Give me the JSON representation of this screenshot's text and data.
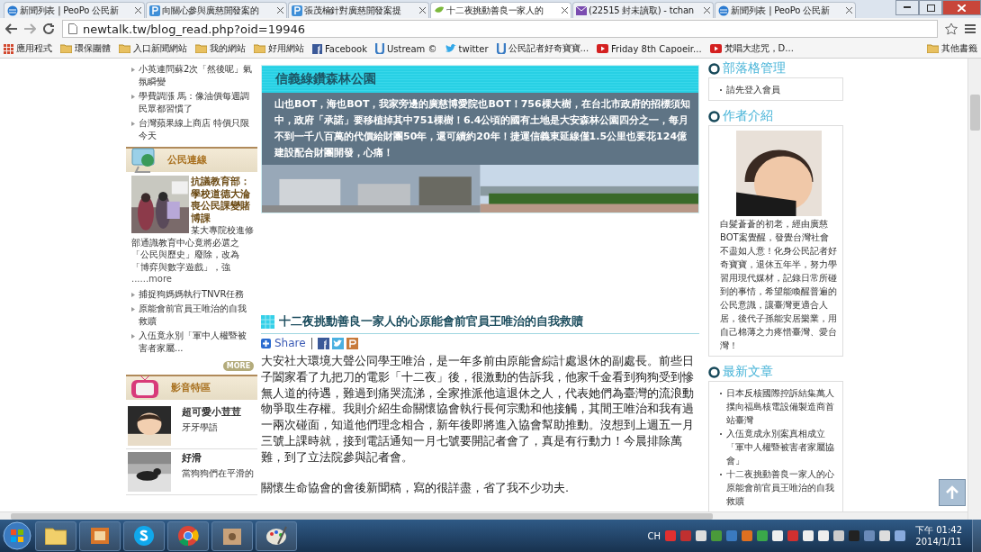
{
  "browser": {
    "tabs": [
      {
        "title": "新聞列表 | PeoPo 公民新",
        "kind": "globe",
        "selected": false
      },
      {
        "title": "向關心參與廣慈開發案的",
        "kind": "p",
        "selected": false
      },
      {
        "title": "張茂楠針對廣慈開發案提",
        "kind": "p",
        "selected": false
      },
      {
        "title": "十二夜挑動善良一家人的",
        "kind": "leaf",
        "selected": true
      },
      {
        "title": "(22515 封未讀取) - tchan",
        "kind": "mail",
        "selected": false
      },
      {
        "title": "新聞列表 | PeoPo 公民新",
        "kind": "globe",
        "selected": false
      }
    ],
    "address": "newtalk.tw/blog_read.php?oid=19946",
    "bookmarks": [
      {
        "label": "應用程式",
        "kind": "apps"
      },
      {
        "label": "環保團體",
        "kind": "folder"
      },
      {
        "label": "入口新聞網站",
        "kind": "folder"
      },
      {
        "label": "我的網站",
        "kind": "folder"
      },
      {
        "label": "好用網站",
        "kind": "folder"
      },
      {
        "label": "Facebook",
        "kind": "facebook"
      },
      {
        "label": "Ustream ©",
        "kind": "ustream"
      },
      {
        "label": "twitter",
        "kind": "twitter"
      },
      {
        "label": "公民記者好奇寶寶...",
        "kind": "ustream"
      },
      {
        "label": "Friday 8th Capoeir...",
        "kind": "youtube"
      },
      {
        "label": "梵唱大悲咒，D...",
        "kind": "youtube"
      },
      {
        "label": "其他書籤",
        "kind": "folder"
      }
    ]
  },
  "left": {
    "news_links": [
      "小英連問蘇2次「然後呢」氣氛瞬變",
      "學費調漲 馬：像油價每週調民眾都習慣了",
      "台灣蘋果線上商店 特價只限今天"
    ],
    "civic": {
      "title": "公民連線",
      "feature_title": "抗議教育部：學校道德大淪喪公民課變賭博課",
      "feature_text": "某大專院校進修部通識教育中心竟將必選之「公民與歷史」廢除，改為「博弈與數字遊戲」，強",
      "more_link": "......more",
      "links": [
        "捕捉狗媽媽執行TNVR任務",
        "原能會前官員王唯治的自我救贖",
        "入伍竟永別「軍中人權暨被害者家屬..."
      ],
      "more_button": "MORE"
    },
    "media": {
      "title": "影音特區",
      "items": [
        {
          "title": "超可愛小荳荳",
          "desc": "牙牙學語"
        },
        {
          "title": "好滑",
          "desc": "當狗狗們在平滑的"
        }
      ]
    }
  },
  "banner": {
    "title": "信義綠鑽森林公園",
    "text": "山也BOT，海也BOT，我家旁邊的廣慈博愛院也BOT！756棵大樹，在台北市政府的招標須知中，政府「承諾」要移植掉其中751棵樹！6.4公頃的國有土地是大安森林公園四分之一，每月不到一千八百萬的代價給財團50年，還可續約20年！捷運信義東延線僅1.5公里也要花124億建設配合財團開發，心痛！"
  },
  "article": {
    "title": "十二夜挑動善良一家人的心原能會前官員王唯治的自我救贖",
    "share": "Share",
    "paragraphs": [
      "大安社大環境大聲公同學王唯治，是一年多前由原能會綜計處退休的副處長。前些日子闔家看了九把刀的電影「十二夜」後，很激動的告訴我，他家千金看到狗狗受到慘無人道的待遇，難過到痛哭流涕，全家推派他這退休之人，代表她們為臺灣的流浪動物爭取生存權。我則介紹生命關懷協會執行長何宗勳和他接觸，其間王唯治和我有過一兩次碰面，知道他們理念相合，新年後即將進入協會幫助推動。沒想到上週五一月三號上課時就，接到電話通知一月七號要開記者會了，真是有行動力！今晨排除萬難，到了立法院參與記者會。",
      "關懷生命協會的會後新聞稿，寫的很詳盡，省了我不少功夫."
    ]
  },
  "right": {
    "blog": {
      "title": "部落格管理",
      "items": [
        "請先登入會員"
      ]
    },
    "author": {
      "title": "作者介紹",
      "bio": "白髮蒼蒼的初老，經由廣慈BOT案覺醒，發覺台灣社會不盡如人意！化身公民記者好奇寶寶，退休五年半，努力學習用現代媒材，記錄日常所碰到的事情，希望能喚醒普遍的公民意識，讓臺灣更適合人居，後代子孫能安居樂業，用自己棉薄之力疼惜臺灣、愛台灣！"
    },
    "latest": {
      "title": "最新文章",
      "items": [
        "日本反核國際控訴結集萬人撲向福島核電設備製造商首站臺灣",
        "入伍竟成永別案真相成立「軍中人權暨被害者家屬協會」",
        "十二夜挑動善良一家人的心原能會前官員王唯治的自我救贖"
      ]
    }
  },
  "taskbar": {
    "apps": [
      {
        "kind": "folder"
      },
      {
        "kind": "media"
      },
      {
        "kind": "skype"
      },
      {
        "kind": "chrome"
      },
      {
        "kind": "box"
      },
      {
        "kind": "paint"
      }
    ],
    "language": "CH",
    "time": "下午 01:42",
    "date": "2014/1/11"
  }
}
